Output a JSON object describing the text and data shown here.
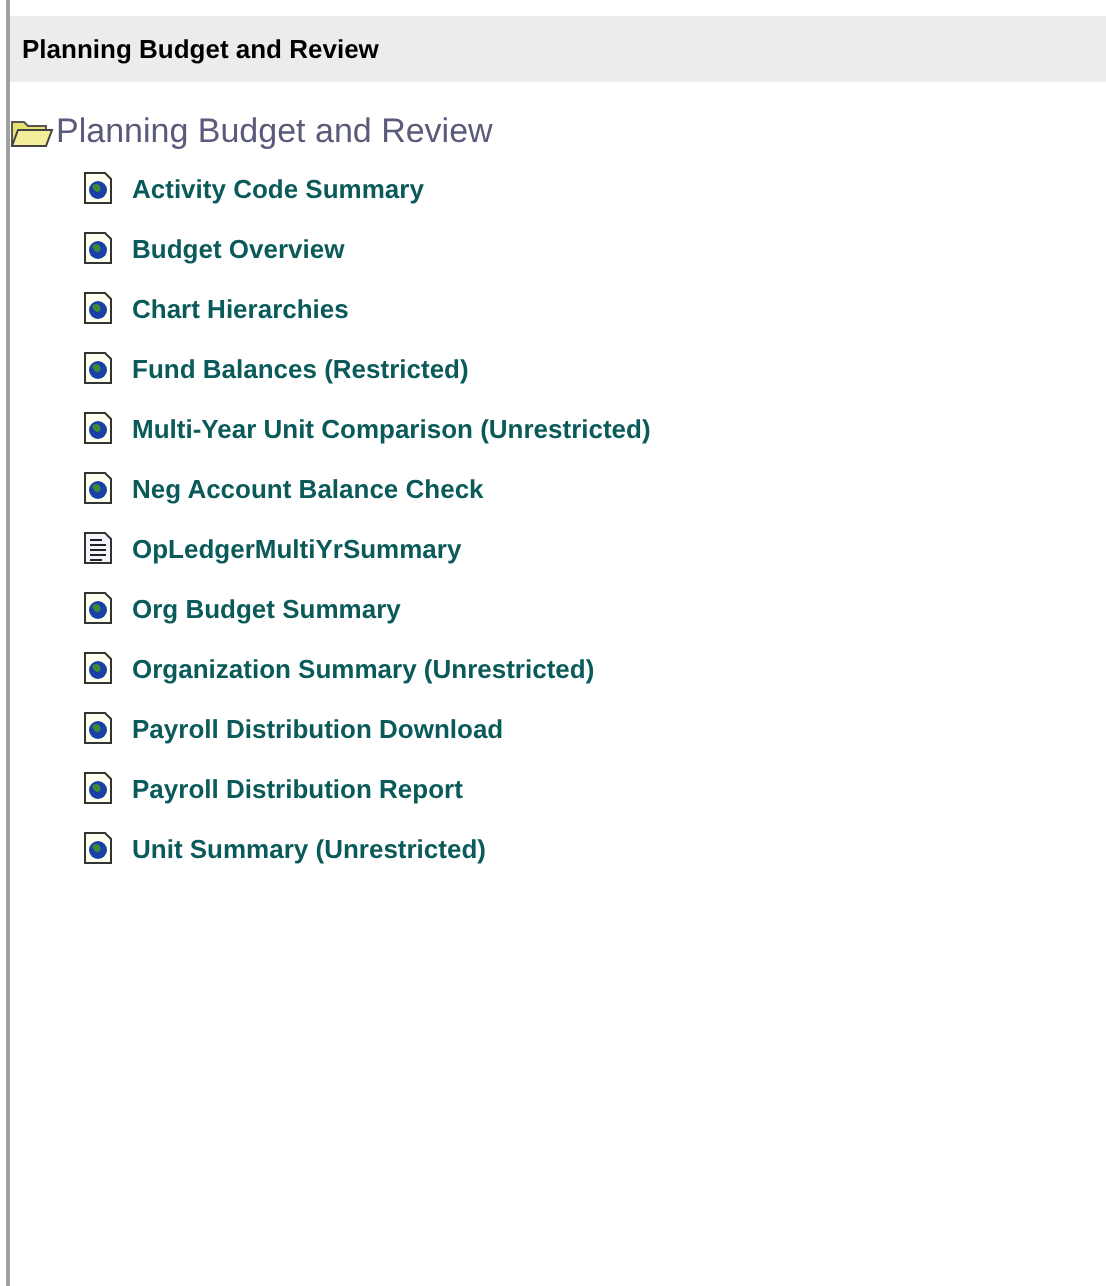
{
  "header": {
    "title": "Planning Budget and Review"
  },
  "folder": {
    "label": "Planning Budget and Review",
    "expanded": true
  },
  "items": [
    {
      "label": "Activity Code Summary",
      "kind": "report"
    },
    {
      "label": "Budget Overview",
      "kind": "report"
    },
    {
      "label": "Chart Hierarchies",
      "kind": "report"
    },
    {
      "label": "Fund Balances (Restricted)",
      "kind": "report"
    },
    {
      "label": "Multi-Year Unit Comparison (Unrestricted)",
      "kind": "report"
    },
    {
      "label": "Neg Account Balance Check",
      "kind": "report"
    },
    {
      "label": "OpLedgerMultiYrSummary",
      "kind": "document"
    },
    {
      "label": "Org Budget Summary",
      "kind": "report"
    },
    {
      "label": "Organization Summary (Unrestricted)",
      "kind": "report"
    },
    {
      "label": "Payroll Distribution Download",
      "kind": "report"
    },
    {
      "label": "Payroll Distribution Report",
      "kind": "report"
    },
    {
      "label": "Unit Summary (Unrestricted)",
      "kind": "report"
    }
  ]
}
